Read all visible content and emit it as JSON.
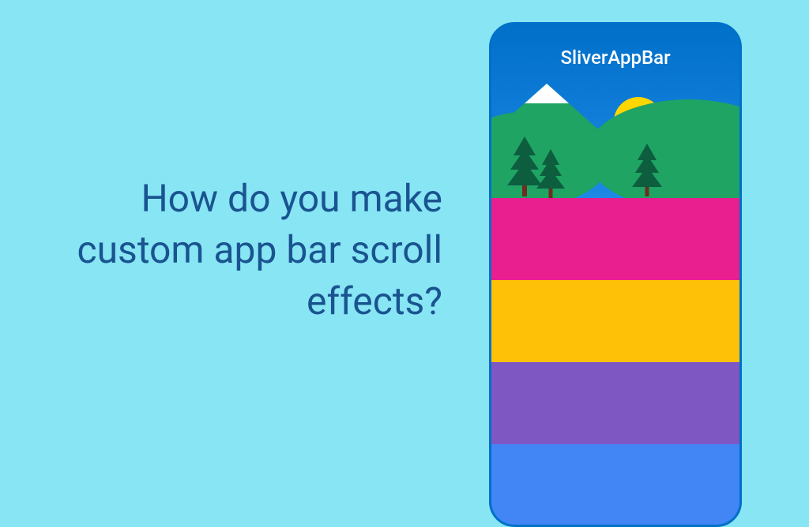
{
  "page": {
    "question": "How do you make custom app bar scroll effects?"
  },
  "phone": {
    "appbar_title": "SliverAppBar",
    "rows": [
      {
        "color": "#E91E8F"
      },
      {
        "color": "#FFC107"
      },
      {
        "color": "#7E57C2"
      },
      {
        "color": "#4285F4"
      }
    ]
  }
}
